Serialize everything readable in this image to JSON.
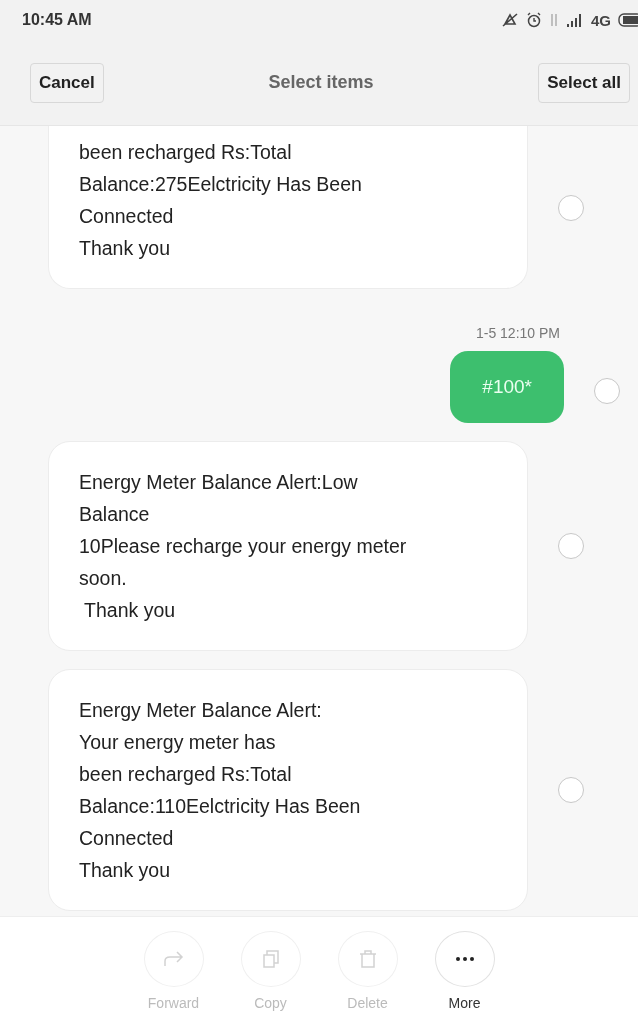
{
  "status_bar": {
    "time": "10:45 AM",
    "network": "4G"
  },
  "header": {
    "cancel": "Cancel",
    "title": "Select items",
    "select_all": "Select all"
  },
  "messages": [
    {
      "kind": "incoming",
      "selected": false,
      "lines": [
        "been recharged Rs:Total",
        "Balance:275Eelctricity Has Been",
        "Connected",
        "Thank you"
      ]
    },
    {
      "kind": "timestamp",
      "text": "1-5 12:10 PM"
    },
    {
      "kind": "outgoing",
      "selected": false,
      "lines": [
        "#100*"
      ]
    },
    {
      "kind": "incoming",
      "selected": false,
      "lines": [
        "Energy Meter Balance Alert:Low",
        "Balance",
        "10Please recharge your energy meter",
        "soon.",
        " Thank you"
      ]
    },
    {
      "kind": "incoming",
      "selected": false,
      "lines": [
        "Energy Meter Balance Alert:",
        "Your energy meter has",
        "been recharged Rs:Total",
        "Balance:110Eelctricity Has Been",
        "Connected",
        "Thank you"
      ]
    }
  ],
  "actions": [
    {
      "kind": "forward",
      "label": "Forward",
      "disabled": true
    },
    {
      "kind": "copy",
      "label": "Copy",
      "disabled": true
    },
    {
      "kind": "delete",
      "label": "Delete",
      "disabled": true
    },
    {
      "kind": "more",
      "label": "More",
      "disabled": false
    }
  ]
}
